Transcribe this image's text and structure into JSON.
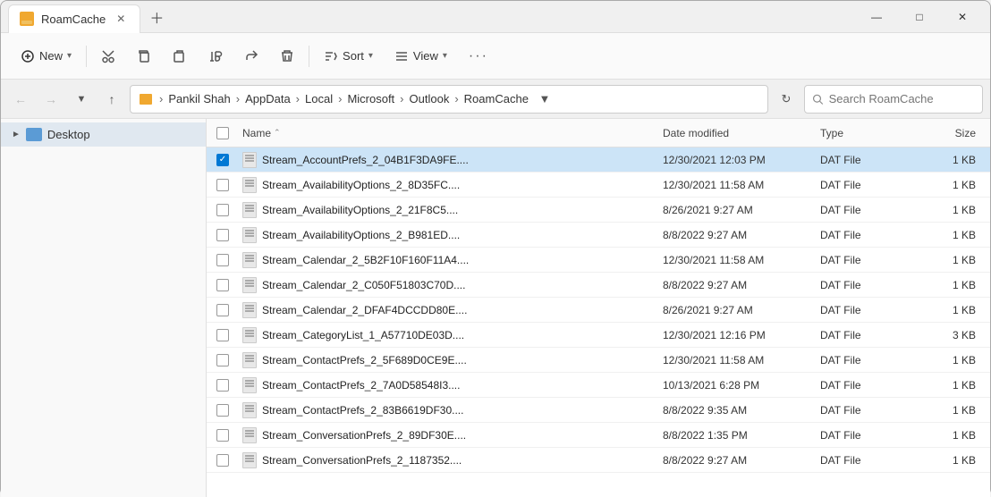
{
  "window": {
    "title": "RoamCache",
    "new_tab_tooltip": "Open new tab"
  },
  "toolbar": {
    "new_label": "New",
    "new_chevron": "▾",
    "cut_tooltip": "Cut",
    "copy_tooltip": "Copy",
    "paste_tooltip": "Paste",
    "rename_tooltip": "Rename",
    "share_tooltip": "Share",
    "delete_tooltip": "Delete",
    "sort_label": "Sort",
    "sort_chevron": "▾",
    "view_label": "View",
    "view_chevron": "▾",
    "more_tooltip": "More options"
  },
  "address_bar": {
    "path_parts": [
      "Pankil Shah",
      "AppData",
      "Local",
      "Microsoft",
      "Outlook",
      "RoamCache"
    ],
    "search_placeholder": "Search RoamCache"
  },
  "sidebar": {
    "items": [
      {
        "label": "Desktop",
        "type": "special"
      }
    ]
  },
  "file_list": {
    "columns": {
      "name": "Name",
      "date_modified": "Date modified",
      "type": "Type",
      "size": "Size"
    },
    "files": [
      {
        "name": "Stream_AccountPrefs_2_04B1F3DA9FE....",
        "date": "12/30/2021 12:03 PM",
        "type": "DAT File",
        "size": "1 KB",
        "selected": true
      },
      {
        "name": "Stream_AvailabilityOptions_2_8D35FC....",
        "date": "12/30/2021 11:58 AM",
        "type": "DAT File",
        "size": "1 KB",
        "selected": false
      },
      {
        "name": "Stream_AvailabilityOptions_2_21F8C5....",
        "date": "8/26/2021 9:27 AM",
        "type": "DAT File",
        "size": "1 KB",
        "selected": false
      },
      {
        "name": "Stream_AvailabilityOptions_2_B981ED....",
        "date": "8/8/2022 9:27 AM",
        "type": "DAT File",
        "size": "1 KB",
        "selected": false
      },
      {
        "name": "Stream_Calendar_2_5B2F10F160F11A4....",
        "date": "12/30/2021 11:58 AM",
        "type": "DAT File",
        "size": "1 KB",
        "selected": false
      },
      {
        "name": "Stream_Calendar_2_C050F51803C70D....",
        "date": "8/8/2022 9:27 AM",
        "type": "DAT File",
        "size": "1 KB",
        "selected": false
      },
      {
        "name": "Stream_Calendar_2_DFAF4DCCDD80E....",
        "date": "8/26/2021 9:27 AM",
        "type": "DAT File",
        "size": "1 KB",
        "selected": false
      },
      {
        "name": "Stream_CategoryList_1_A57710DE03D....",
        "date": "12/30/2021 12:16 PM",
        "type": "DAT File",
        "size": "3 KB",
        "selected": false
      },
      {
        "name": "Stream_ContactPrefs_2_5F689D0CE9E....",
        "date": "12/30/2021 11:58 AM",
        "type": "DAT File",
        "size": "1 KB",
        "selected": false
      },
      {
        "name": "Stream_ContactPrefs_2_7A0D58548I3....",
        "date": "10/13/2021 6:28 PM",
        "type": "DAT File",
        "size": "1 KB",
        "selected": false
      },
      {
        "name": "Stream_ContactPrefs_2_83B6619DF30....",
        "date": "8/8/2022 9:35 AM",
        "type": "DAT File",
        "size": "1 KB",
        "selected": false
      },
      {
        "name": "Stream_ConversationPrefs_2_89DF30E....",
        "date": "8/8/2022 1:35 PM",
        "type": "DAT File",
        "size": "1 KB",
        "selected": false
      },
      {
        "name": "Stream_ConversationPrefs_2_1187352....",
        "date": "8/8/2022 9:27 AM",
        "type": "DAT File",
        "size": "1 KB",
        "selected": false
      }
    ]
  },
  "colors": {
    "selected_row_bg": "#cce4f7",
    "folder_icon": "#f0a830",
    "accent": "#0078d4"
  }
}
